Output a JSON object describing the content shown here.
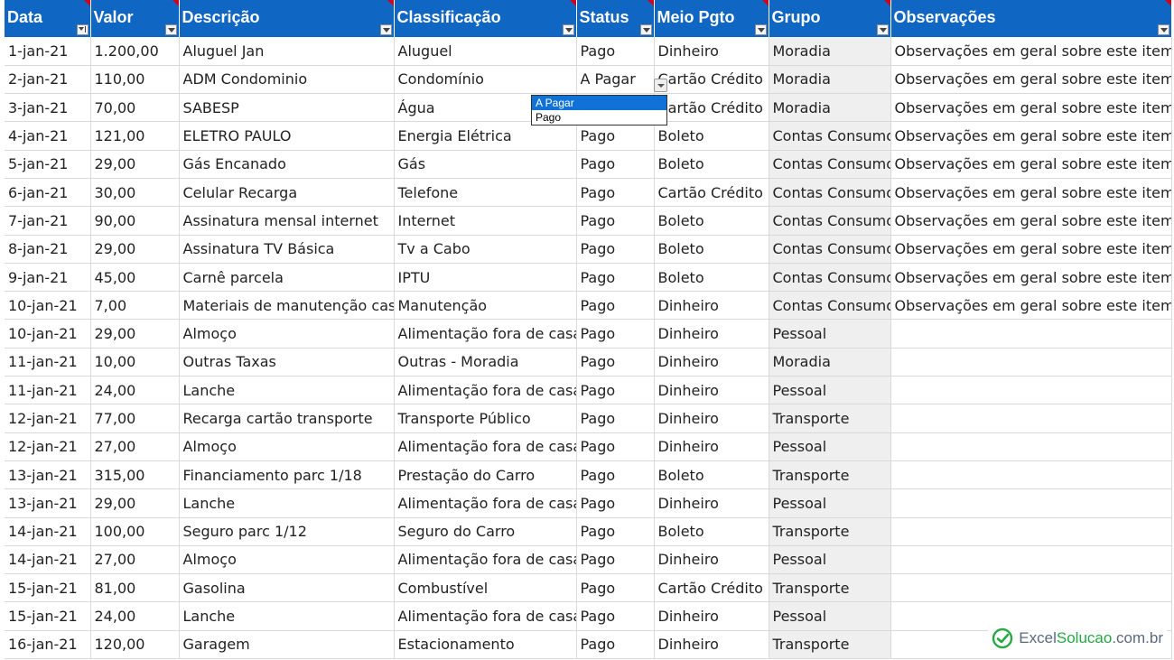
{
  "headers": [
    "Data",
    "Valor",
    "Descrição",
    "Classificação",
    "Status",
    "Meio Pgto",
    "Grupo",
    "Observações"
  ],
  "rows": [
    [
      "1-jan-21",
      "1.200,00",
      "Aluguel Jan",
      "Aluguel",
      "Pago",
      "Dinheiro",
      "Moradia",
      "Observações em geral sobre este item"
    ],
    [
      "2-jan-21",
      "110,00",
      "ADM Condominio",
      "Condomínio",
      "A Pagar",
      "Cartão Crédito",
      "Moradia",
      "Observações em geral sobre este item"
    ],
    [
      "3-jan-21",
      "70,00",
      "SABESP",
      "Água",
      "",
      "Cartão Crédito",
      "Moradia",
      "Observações em geral sobre este item"
    ],
    [
      "4-jan-21",
      "121,00",
      "ELETRO PAULO",
      "Energia Elétrica",
      "Pago",
      "Boleto",
      "Contas Consumo",
      "Observações em geral sobre este item"
    ],
    [
      "5-jan-21",
      "29,00",
      "Gás Encanado",
      "Gás",
      "Pago",
      "Boleto",
      "Contas Consumo",
      "Observações em geral sobre este item"
    ],
    [
      "6-jan-21",
      "30,00",
      "Celular Recarga",
      "Telefone",
      "Pago",
      "Cartão Crédito",
      "Contas Consumo",
      "Observações em geral sobre este item"
    ],
    [
      "7-jan-21",
      "90,00",
      "Assinatura mensal internet",
      "Internet",
      "Pago",
      "Boleto",
      "Contas Consumo",
      "Observações em geral sobre este item"
    ],
    [
      "8-jan-21",
      "29,00",
      "Assinatura TV Básica",
      "Tv a Cabo",
      "Pago",
      "Boleto",
      "Contas Consumo",
      "Observações em geral sobre este item"
    ],
    [
      "9-jan-21",
      "45,00",
      "Carnê parcela",
      "IPTU",
      "Pago",
      "Boleto",
      "Contas Consumo",
      "Observações em geral sobre este item"
    ],
    [
      "10-jan-21",
      "7,00",
      "Materiais de manutenção casa",
      "Manutenção",
      "Pago",
      "Dinheiro",
      "Contas Consumo",
      "Observações em geral sobre este item"
    ],
    [
      "10-jan-21",
      "29,00",
      "Almoço",
      "Alimentação fora de casa",
      "Pago",
      "Dinheiro",
      "Pessoal",
      ""
    ],
    [
      "11-jan-21",
      "10,00",
      "Outras Taxas",
      "Outras - Moradia",
      "Pago",
      "Dinheiro",
      "Moradia",
      ""
    ],
    [
      "11-jan-21",
      "24,00",
      "Lanche",
      "Alimentação fora de casa",
      "Pago",
      "Dinheiro",
      "Pessoal",
      ""
    ],
    [
      "12-jan-21",
      "77,00",
      "Recarga cartão transporte",
      "Transporte Público",
      "Pago",
      "Dinheiro",
      "Transporte",
      ""
    ],
    [
      "12-jan-21",
      "27,00",
      "Almoço",
      "Alimentação fora de casa",
      "Pago",
      "Dinheiro",
      "Pessoal",
      ""
    ],
    [
      "13-jan-21",
      "315,00",
      "Financiamento parc 1/18",
      "Prestação do Carro",
      "Pago",
      "Boleto",
      "Transporte",
      ""
    ],
    [
      "13-jan-21",
      "29,00",
      "Lanche",
      "Alimentação fora de casa",
      "Pago",
      "Dinheiro",
      "Pessoal",
      ""
    ],
    [
      "14-jan-21",
      "100,00",
      "Seguro parc 1/12",
      "Seguro do Carro",
      "Pago",
      "Boleto",
      "Transporte",
      ""
    ],
    [
      "14-jan-21",
      "27,00",
      "Almoço",
      "Alimentação fora de casa",
      "Pago",
      "Dinheiro",
      "Pessoal",
      ""
    ],
    [
      "15-jan-21",
      "81,00",
      "Gasolina",
      "Combustível",
      "Pago",
      "Cartão Crédito",
      "Transporte",
      ""
    ],
    [
      "15-jan-21",
      "24,00",
      "Lanche",
      "Alimentação fora de casa",
      "Pago",
      "Dinheiro",
      "Pessoal",
      ""
    ],
    [
      "16-jan-21",
      "120,00",
      "Garagem",
      "Estacionamento",
      "Pago",
      "Dinheiro",
      "Transporte",
      ""
    ]
  ],
  "dropdown": {
    "options": [
      "A Pagar",
      "Pago"
    ],
    "selected_index": 0
  },
  "watermark": {
    "part1": "Excel",
    "part2": "Solucao",
    "part3": ".com.br"
  },
  "colors": {
    "header_bg": "#0f66c3",
    "header_text": "#ffffff",
    "grid": "#d9d9d9",
    "group_bg": "#efefef",
    "selection": "#1072d6",
    "brand_green": "#28a745"
  }
}
